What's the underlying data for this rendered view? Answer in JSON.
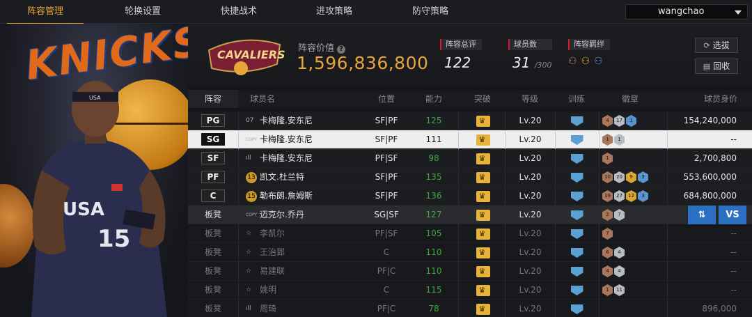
{
  "nav": {
    "tabs": [
      "阵容管理",
      "轮换设置",
      "快捷战术",
      "进攻策略",
      "防守策略"
    ],
    "active": 0,
    "username": "wangchao"
  },
  "banner_text": "KNICKS",
  "team_logo_text": "CAVALIERS",
  "lineup": {
    "value_label": "阵容价值",
    "value": "1,596,836,800",
    "rating_label": "阵容总评",
    "rating": "122",
    "count_label": "球员数",
    "count": "31",
    "count_max": "/300",
    "bond_label": "阵容羁绊",
    "select_label": "选拔",
    "recycle_label": "回收"
  },
  "table": {
    "headers": [
      "阵容",
      "球员名",
      "位置",
      "能力",
      "突破",
      "等级",
      "训练",
      "徽章",
      "球员身价"
    ],
    "swap_label": "⇅",
    "vs_label": "VS",
    "rows": [
      {
        "slot": "PG",
        "num": "07",
        "num_type": "plain",
        "name": "卡梅隆.安东尼",
        "pos": "SF|PF",
        "ability": "125",
        "level": "Lv.20",
        "badges": [
          [
            "br",
            "4"
          ],
          [
            "si",
            "17"
          ],
          [
            "bl",
            "1"
          ]
        ],
        "price": "154,240,000",
        "kind": "starter"
      },
      {
        "slot": "SG",
        "num": "COPY",
        "num_type": "copy",
        "name": "卡梅隆.安东尼",
        "pos": "SF|PF",
        "ability": "111",
        "level": "Lv.20",
        "badges": [
          [
            "br",
            "1"
          ],
          [
            "si",
            "1"
          ]
        ],
        "price": "--",
        "kind": "sel"
      },
      {
        "slot": "SF",
        "num": "ıll",
        "num_type": "plain",
        "name": "卡梅隆.安东尼",
        "pos": "PF|SF",
        "ability": "98",
        "level": "Lv.20",
        "badges": [
          [
            "br",
            "1"
          ]
        ],
        "price": "2,700,800",
        "kind": "starter"
      },
      {
        "slot": "PF",
        "num": "13",
        "num_type": "gold",
        "name": "凯文.杜兰特",
        "pos": "SF|PF",
        "ability": "135",
        "level": "Lv.20",
        "badges": [
          [
            "br",
            "10"
          ],
          [
            "si",
            "20"
          ],
          [
            "go",
            "9"
          ],
          [
            "bl",
            "3"
          ]
        ],
        "price": "553,600,000",
        "kind": "starter"
      },
      {
        "slot": "C",
        "num": "15",
        "num_type": "gold",
        "name": "勒布朗.詹姆斯",
        "pos": "SF|PF",
        "ability": "136",
        "level": "Lv.20",
        "badges": [
          [
            "br",
            "19"
          ],
          [
            "si",
            "27"
          ],
          [
            "go",
            "12"
          ],
          [
            "bl",
            "3"
          ]
        ],
        "price": "684,800,000",
        "kind": "starter"
      },
      {
        "slot": "板凳",
        "num": "COPY",
        "num_type": "copy",
        "name": "迈克尔.乔丹",
        "pos": "SG|SF",
        "ability": "127",
        "level": "Lv.20",
        "badges": [
          [
            "br",
            "2"
          ],
          [
            "si",
            "7"
          ]
        ],
        "price": "",
        "kind": "hov"
      },
      {
        "slot": "板凳",
        "num": "☆",
        "num_type": "plain",
        "name": "李凯尔",
        "pos": "PF|SF",
        "ability": "105",
        "level": "Lv.20",
        "badges": [
          [
            "br",
            "7"
          ]
        ],
        "price": "--",
        "kind": "bench"
      },
      {
        "slot": "板凳",
        "num": "☆",
        "num_type": "plain",
        "name": "王治郅",
        "pos": "C",
        "ability": "110",
        "level": "Lv.20",
        "badges": [
          [
            "br",
            "6"
          ],
          [
            "si",
            "4"
          ]
        ],
        "price": "--",
        "kind": "bench"
      },
      {
        "slot": "板凳",
        "num": "☆",
        "num_type": "plain",
        "name": "易建联",
        "pos": "PF|C",
        "ability": "110",
        "level": "Lv.20",
        "badges": [
          [
            "br",
            "4"
          ],
          [
            "si",
            "4"
          ]
        ],
        "price": "--",
        "kind": "bench"
      },
      {
        "slot": "板凳",
        "num": "☆",
        "num_type": "plain",
        "name": "姚明",
        "pos": "C",
        "ability": "115",
        "level": "Lv.20",
        "badges": [
          [
            "br",
            "1"
          ],
          [
            "si",
            "11"
          ]
        ],
        "price": "--",
        "kind": "bench"
      },
      {
        "slot": "板凳",
        "num": "ıll",
        "num_type": "plain",
        "name": "周琦",
        "pos": "PF|C",
        "ability": "78",
        "level": "Lv.20",
        "badges": [],
        "price": "896,000",
        "kind": "bench"
      }
    ]
  }
}
